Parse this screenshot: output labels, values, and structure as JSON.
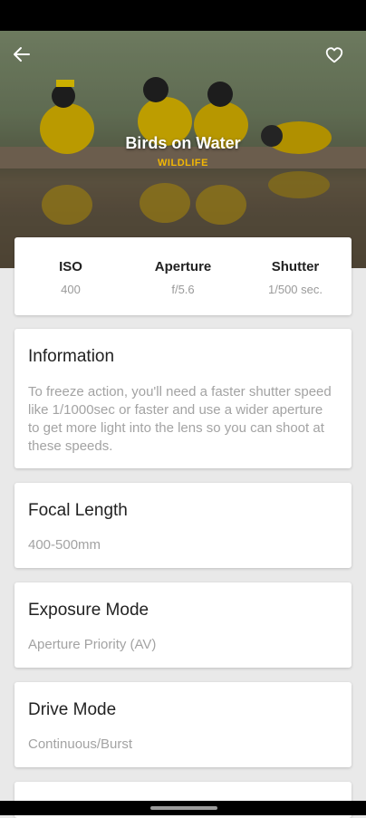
{
  "header": {
    "title": "Birds on Water",
    "category": "WILDLIFE",
    "back_icon": "arrow-left-icon",
    "favorite_icon": "heart-outline-icon"
  },
  "stats": [
    {
      "label": "ISO",
      "value": "400"
    },
    {
      "label": "Aperture",
      "value": "f/5.6"
    },
    {
      "label": "Shutter",
      "value": "1/500 sec."
    }
  ],
  "information": {
    "title": "Information",
    "text": "To freeze action, you'll need a faster shutter speed like 1/1000sec or faster and use a wider aperture to get more light into the lens so you can shoot at these speeds."
  },
  "focal_length": {
    "title": "Focal Length",
    "value": "400-500mm"
  },
  "exposure_mode": {
    "title": "Exposure Mode",
    "value": "Aperture Priority (AV)"
  },
  "drive_mode": {
    "title": "Drive Mode",
    "value": "Continuous/Burst"
  },
  "colors": {
    "accent": "#f2b705",
    "card_bg": "#ffffff",
    "page_bg": "#e9e9e9"
  }
}
